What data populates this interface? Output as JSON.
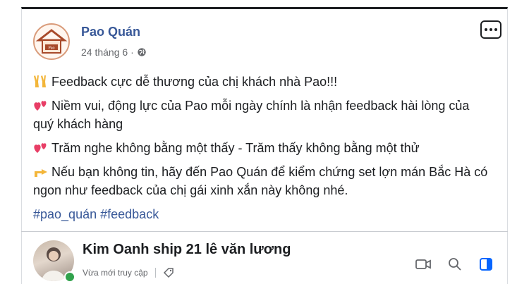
{
  "post": {
    "page_name": "Pao Quán",
    "logo_text": "Pao",
    "date": "24 tháng 6",
    "separator": "·",
    "paragraphs": [
      {
        "emoji": "victory-hands-icon",
        "text": "Feedback cực dễ thương của chị khách nhà Pao!!!"
      },
      {
        "emoji": "hearts-icon",
        "text": "Niềm vui, động lực của Pao mỗi ngày chính là nhận feedback hài lòng của quý khách hàng"
      },
      {
        "emoji": "hearts-icon",
        "text": "Trăm nghe không bằng một thấy - Trăm thấy không bằng một thử"
      },
      {
        "emoji": "pointing-hand-icon",
        "text": "Nếu bạn không tin, hãy đến Pao Quán để kiểm chứng set lợn mán Bắc Hà có ngon như feedback của chị gái xinh xắn này không nhé."
      }
    ],
    "hashtags": [
      "#pao_quán",
      "#feedback"
    ]
  },
  "chat": {
    "name": "Kim Oanh ship 21 lê văn lương",
    "status": "Vừa mới truy cập"
  },
  "colors": {
    "link": "#385898",
    "text": "#1c1e21",
    "muted": "#65676b",
    "online": "#31a24c",
    "accent": "#0866ff"
  }
}
